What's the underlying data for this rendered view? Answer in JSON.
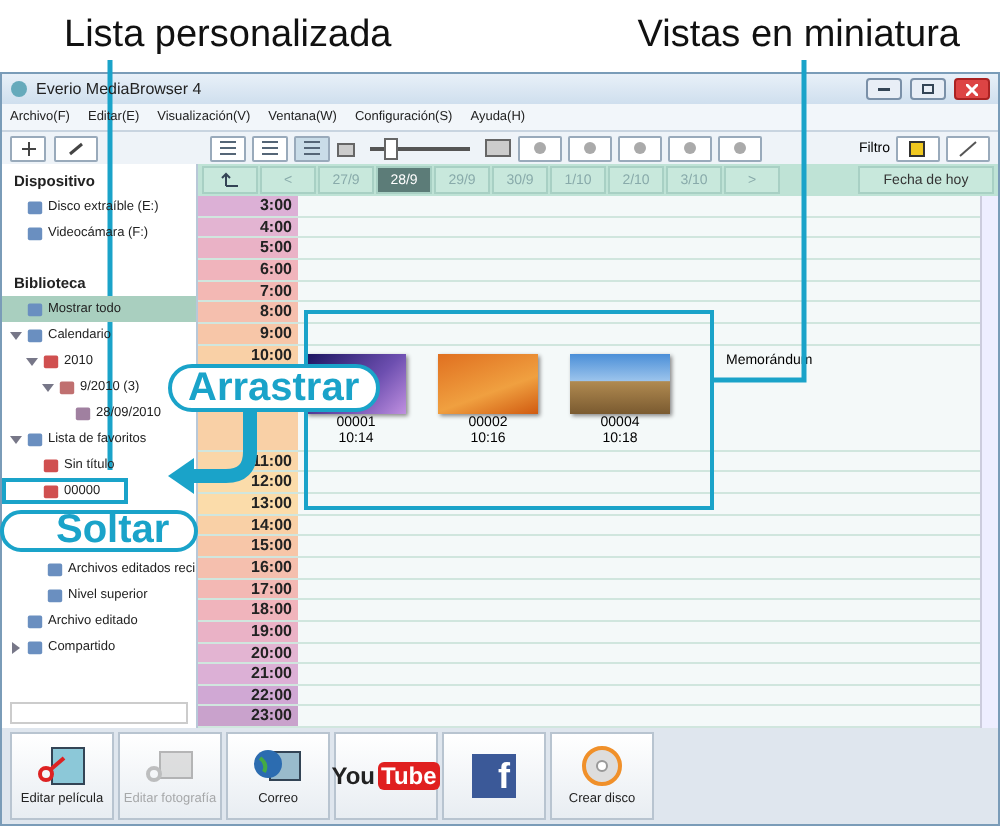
{
  "callouts": {
    "labels": [
      "Lista personalizada",
      "Vistas en miniatura"
    ],
    "drag": "Arrastrar",
    "drop": "Soltar"
  },
  "window": {
    "title": "Everio MediaBrowser 4"
  },
  "menu": [
    "Archivo(F)",
    "Editar(E)",
    "Visualización(V)",
    "Ventana(W)",
    "Configuración(S)",
    "Ayuda(H)"
  ],
  "toolbar": {
    "views": [
      {
        "selected": false
      },
      {
        "selected": false
      },
      {
        "selected": true
      }
    ],
    "zoom": {
      "level": 0.2
    },
    "filter_label": "Filtro"
  },
  "sidebar": {
    "sections": [
      {
        "heading": "Dispositivo",
        "items": [
          {
            "label": "Disco extraíble (E:)",
            "selected": false
          },
          {
            "label": "Videocámara (F:)",
            "selected": false
          }
        ]
      },
      {
        "heading": "Biblioteca",
        "items": [
          {
            "label": "Mostrar todo",
            "selected": true
          },
          {
            "label": "Calendario",
            "selected": false,
            "expanded": true,
            "children": [
              {
                "label": "2010",
                "selected": false,
                "expanded": true,
                "children": [
                  {
                    "label": "9/2010 (3)",
                    "selected": false,
                    "expanded": true,
                    "children": [
                      {
                        "label": "28/09/2010",
                        "selected": false
                      }
                    ]
                  }
                ]
              }
            ]
          },
          {
            "label": "Lista de favoritos",
            "selected": false,
            "expanded": true,
            "children": [
              {
                "label": "Sin título",
                "selected": false
              },
              {
                "label": "00000",
                "selected": false,
                "drop_target": true
              }
            ]
          },
          {
            "label": "Archivos editados reci",
            "selected": false,
            "indent": true
          },
          {
            "label": "Nivel superior",
            "selected": false,
            "indent": true
          },
          {
            "label": "Archivo editado",
            "selected": false
          },
          {
            "label": "Compartido",
            "selected": false,
            "expanded": false
          }
        ]
      }
    ]
  },
  "date_strip": {
    "prev": "<",
    "next": ">",
    "dates": [
      {
        "label": "27/9",
        "selected": false
      },
      {
        "label": "28/9",
        "selected": true
      },
      {
        "label": "29/9",
        "selected": false
      },
      {
        "label": "30/9",
        "selected": false
      },
      {
        "label": "1/10",
        "selected": false
      },
      {
        "label": "2/10",
        "selected": false
      },
      {
        "label": "3/10",
        "selected": false
      }
    ],
    "today": "Fecha de hoy"
  },
  "hours": [
    "3:00",
    "4:00",
    "5:00",
    "6:00",
    "7:00",
    "8:00",
    "9:00",
    "10:00",
    "11:00",
    "12:00",
    "13:00",
    "14:00",
    "15:00",
    "16:00",
    "17:00",
    "18:00",
    "19:00",
    "20:00",
    "21:00",
    "22:00",
    "23:00"
  ],
  "thumbnails": [
    {
      "label": "00001",
      "time": "10:14"
    },
    {
      "label": "00002",
      "time": "10:16"
    },
    {
      "label": "00004",
      "time": "10:18"
    }
  ],
  "memo": "Memorándum",
  "bottom_buttons": [
    {
      "kind": "movie",
      "label": "Editar película",
      "disabled": false
    },
    {
      "kind": "photo",
      "label": "Editar fotografía",
      "disabled": true
    },
    {
      "kind": "mail",
      "label": "Correo",
      "disabled": false
    },
    {
      "kind": "youtube",
      "logo": [
        "You",
        "Tube"
      ],
      "disabled": false
    },
    {
      "kind": "facebook",
      "logo": "f",
      "disabled": false
    },
    {
      "kind": "disc",
      "label": "Crear disco",
      "disabled": false
    }
  ]
}
